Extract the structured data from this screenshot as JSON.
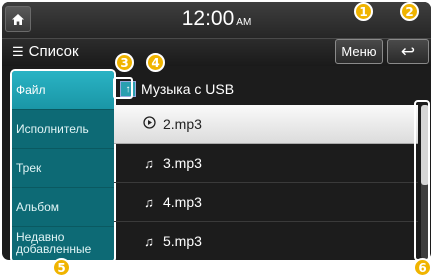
{
  "statusbar": {
    "time": "12:00",
    "ampm": "AM"
  },
  "header": {
    "list_label": "Список",
    "menu_label": "Меню",
    "back_glyph": "↩"
  },
  "sidebar": {
    "items": [
      {
        "label": "Файл",
        "active": true
      },
      {
        "label": "Исполнитель",
        "active": false
      },
      {
        "label": "Трек",
        "active": false
      },
      {
        "label": "Альбом",
        "active": false
      },
      {
        "label_line1": "Недавно",
        "label_line2": "добавленные",
        "active": false
      }
    ]
  },
  "folder": {
    "name": "Музыка с USB"
  },
  "files": [
    {
      "name": "2.mp3",
      "icon": "play-icon",
      "selected": true
    },
    {
      "name": "3.mp3",
      "icon": "music-note-icon",
      "selected": false
    },
    {
      "name": "4.mp3",
      "icon": "music-note-icon",
      "selected": false
    },
    {
      "name": "5.mp3",
      "icon": "music-note-icon",
      "selected": false
    }
  ],
  "callouts": [
    "1",
    "2",
    "3",
    "4",
    "5",
    "6"
  ],
  "colors": {
    "accent": "#1a96a6",
    "callout": "#f0b400",
    "sidebar": "#0d6a75"
  }
}
